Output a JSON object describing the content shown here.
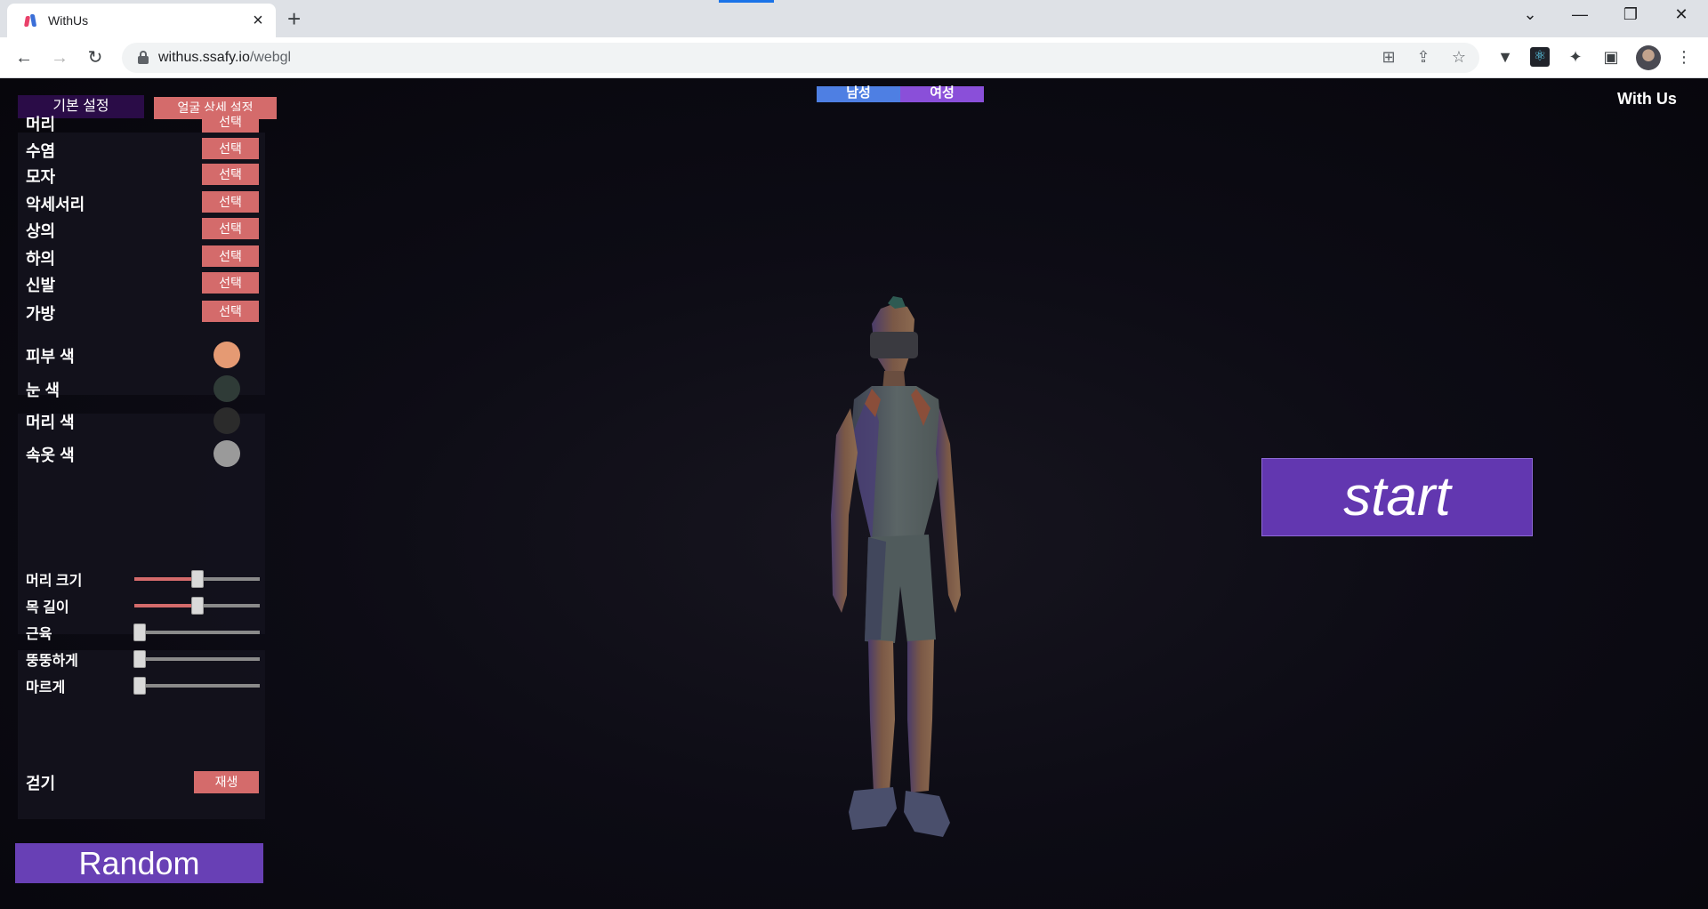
{
  "browser": {
    "tab_title": "WithUs",
    "tab_close": "×",
    "new_tab": "+",
    "url_host": "withus.ssafy.io",
    "url_path": "/webgl",
    "window": {
      "minimize": "—",
      "restore": "❐",
      "close": "✕",
      "tab_search": "⌄"
    },
    "nav": {
      "back": "←",
      "forward": "→",
      "reload": "↻"
    },
    "omnibox_icons": {
      "translate": "⊞",
      "share": "⇪",
      "bookmark": "☆"
    },
    "extensions": {
      "vivaldi": "▼",
      "react": "⚛",
      "puzzle": "✦",
      "sidepanel": "▣",
      "menu": "⋮"
    }
  },
  "app": {
    "brand": "With Us",
    "mode_tabs": {
      "basic": "기본 설정",
      "face": "얼굴 상세 설정"
    },
    "gender": {
      "male": "남성",
      "female": "여성"
    },
    "parts": [
      {
        "label": "머리",
        "button": "선택"
      },
      {
        "label": "수염",
        "button": "선택"
      },
      {
        "label": "모자",
        "button": "선택"
      },
      {
        "label": "악세서리",
        "button": "선택"
      },
      {
        "label": "상의",
        "button": "선택"
      },
      {
        "label": "하의",
        "button": "선택"
      },
      {
        "label": "신발",
        "button": "선택"
      },
      {
        "label": "가방",
        "button": "선택"
      }
    ],
    "colors": [
      {
        "label": "피부 색",
        "color": "#e59a73"
      },
      {
        "label": "눈 색",
        "color": "#2f3b37"
      },
      {
        "label": "머리 색",
        "color": "#2b2b2b"
      },
      {
        "label": "속옷 색",
        "color": "#9a9a9a"
      }
    ],
    "sliders": [
      {
        "label": "머리 크기",
        "value": 0.5
      },
      {
        "label": "목 길이",
        "value": 0.5
      },
      {
        "label": "근육",
        "value": 0
      },
      {
        "label": "뚱뚱하게",
        "value": 0
      },
      {
        "label": "마르게",
        "value": 0
      }
    ],
    "animation": {
      "label": "걷기",
      "button": "재생"
    },
    "random_button": "Random",
    "start_button": "start"
  }
}
